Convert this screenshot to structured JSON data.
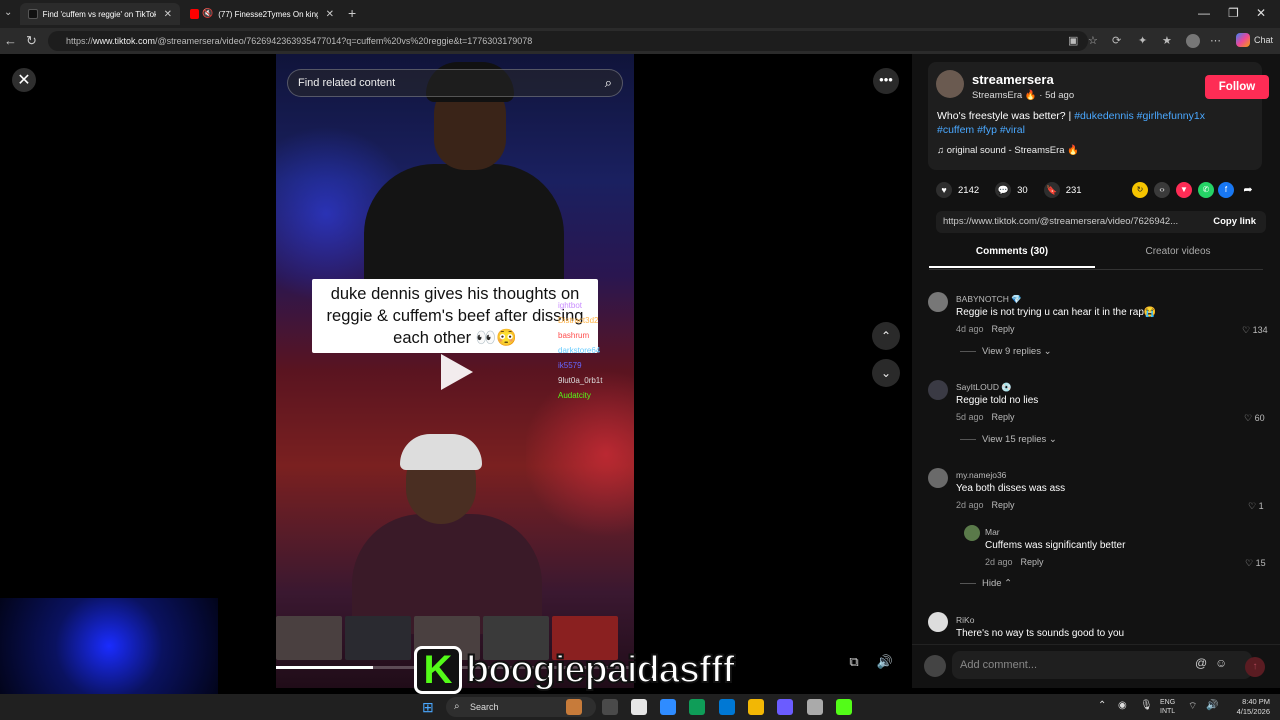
{
  "browser": {
    "tabs": [
      {
        "label": "Find 'cuffem vs reggie' on TikTok |",
        "favicon_color": "#111111"
      },
      {
        "label": "(77) Finesse2Tymes On king I",
        "favicon_color": "#ff0000"
      }
    ],
    "new_tab": "+",
    "url_prefix": "https://",
    "url_domain": "www.tiktok.com",
    "url_path": "/@streamersera/video/7626942363935477014?q=cuffem%20vs%20reggie&t=1776303179078",
    "chat_label": "Chat"
  },
  "video": {
    "search_placeholder": "Find related content",
    "caption": "duke dennis gives his thoughts on reggie & cuffem's beef after dissing each other 👀😳",
    "chat_overlay": [
      {
        "text": "ightbot",
        "color": "#c98cff"
      },
      {
        "text": "Distract3d2",
        "color": "#ffb347"
      },
      {
        "text": "bashrum",
        "color": "#ff4d4d"
      },
      {
        "text": "darkstore64",
        "color": "#66ccff"
      },
      {
        "text": "",
        "color": "#ff66cc"
      },
      {
        "text": "",
        "color": "#9999ff"
      },
      {
        "text": "ik5579",
        "color": "#6666ff"
      },
      {
        "text": "9lut0a_0rb1t",
        "color": "#dddddd"
      },
      {
        "text": "",
        "color": "#5555ff"
      },
      {
        "text": "Audatcity",
        "color": "#53fc18"
      }
    ],
    "progress": 0.27,
    "more_label": "•••",
    "up_label": "⌃",
    "down_label": "⌄"
  },
  "post": {
    "author": "streamersera",
    "author_sub": "StreamsEra 🔥 · 5d ago",
    "follow_label": "Follow",
    "desc_text": "Who's freestyle was better? |",
    "hashtags_line1": "#dukedennis #girlhefunny1x",
    "hashtags_line2": "#cuffem #fyp #viral",
    "sound": "♫  original sound - StreamsEra 🔥",
    "likes": "2142",
    "comments": "30",
    "saves": "231",
    "link": "https://www.tiktok.com/@streamersera/video/7626942...",
    "copy_link": "Copy link",
    "share_colors": [
      "#f5c400",
      "#3a3a3a",
      "#fe2c55",
      "#25d366",
      "#1877f2",
      "#121212"
    ]
  },
  "tabs": {
    "comments": "Comments (30)",
    "creator": "Creator videos"
  },
  "comments": [
    {
      "user": "BABYNOTCH 💎",
      "text": "Reggie is not trying u can hear it in the rap😭",
      "date": "4d ago",
      "reply": "Reply",
      "likes": "134",
      "view_replies": "View 9 replies ⌄"
    },
    {
      "user": "SayItLOUD 💿",
      "text": "Reggie told no lies",
      "date": "5d ago",
      "reply": "Reply",
      "likes": "60",
      "view_replies": "View 15 replies ⌄"
    },
    {
      "user": "my.namejo36",
      "text": "Yea both disses was ass",
      "date": "2d ago",
      "reply": "Reply",
      "likes": "1"
    },
    {
      "user": "Mar",
      "text": "Cuffems was significantly better",
      "date": "2d ago",
      "reply": "Reply",
      "likes": "15",
      "hide": "Hide ⌃"
    },
    {
      "user": "RiKo",
      "text": "There's no way ts sounds good to you"
    }
  ],
  "comment_input": {
    "placeholder": "Add comment..."
  },
  "overlay": {
    "k_letter": "K",
    "streamer": "boogiepaidasfff"
  },
  "taskbar": {
    "search": "Search",
    "lang_line1": "ENG",
    "lang_line2": "INTL",
    "time": "8:40 PM",
    "date": "4/15/2026",
    "app_colors": [
      "#c77b3a",
      "#4a4a4a",
      "#e6e6e6",
      "#2f8cff",
      "#0f9d58",
      "#0078d4",
      "#f2b705",
      "#6b5cff",
      "#aaaaaa",
      "#53fc18"
    ]
  }
}
